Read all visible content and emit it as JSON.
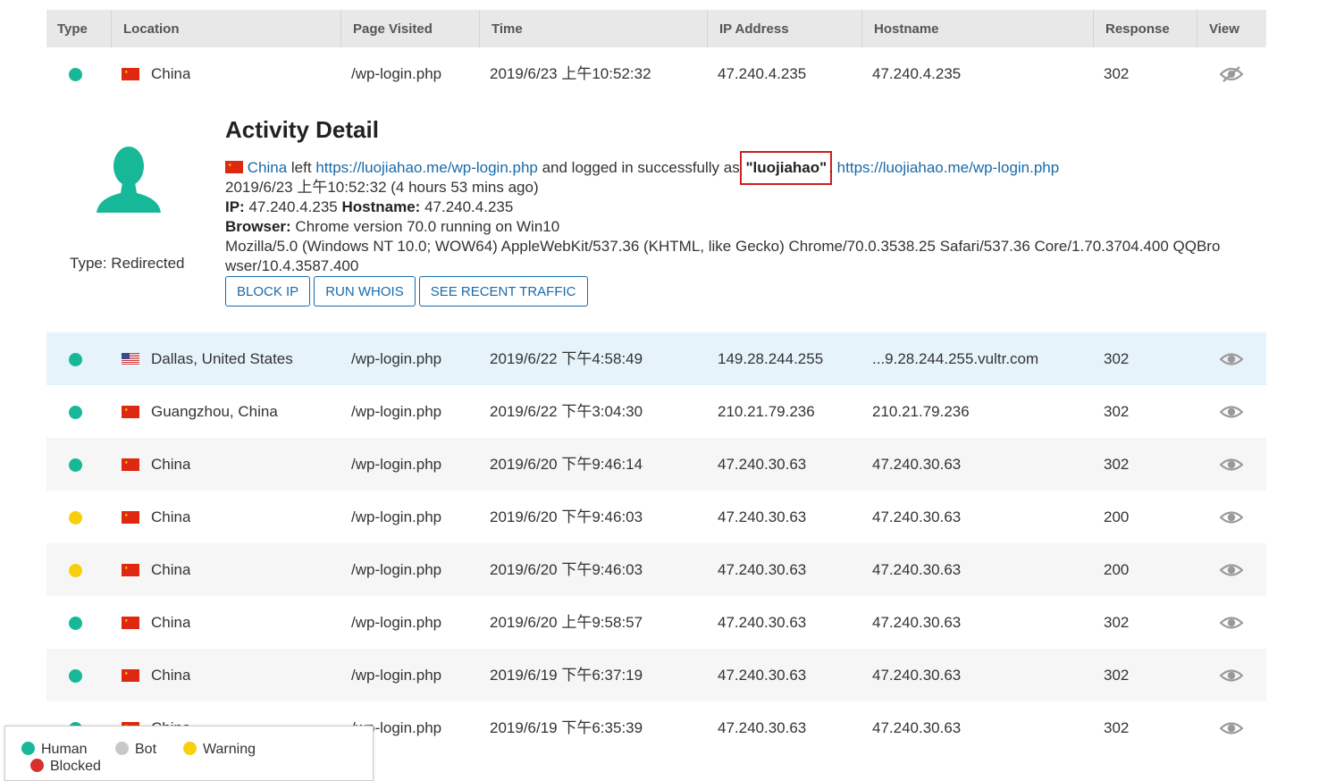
{
  "columns": [
    "Type",
    "Location",
    "Page Visited",
    "Time",
    "IP Address",
    "Hostname",
    "Response",
    "View"
  ],
  "colors": {
    "human": "#16b897",
    "bot": "#c8c8c8",
    "warning": "#f8cf0d",
    "blocked": "#d63030",
    "link": "#1a6aa8",
    "highlight": "#cc1f1f"
  },
  "first_row": {
    "type": "human",
    "flag": "cn",
    "location": "China",
    "page": "/wp-login.php",
    "time": "2019/6/23 上午10:52:32",
    "ip": "47.240.4.235",
    "hostname": "47.240.4.235",
    "response": "302",
    "view_icon": "eye-slash-icon"
  },
  "detail": {
    "title": "Activity Detail",
    "type_label": "Type: Redirected",
    "country": "China",
    "left_text": "left",
    "left_url": "https://luojiahao.me/wp-login.php",
    "login_text": "and logged in successfully as",
    "username": "\"luojiahao\"",
    "dest_url": "https://luojiahao.me/wp-login.php",
    "time_line": "2019/6/23 上午10:52:32 (4 hours 53 mins ago)",
    "ip_label": "IP:",
    "ip": "47.240.4.235",
    "hostname_label": "Hostname:",
    "hostname": "47.240.4.235",
    "browser_label": "Browser:",
    "browser": "Chrome version 70.0 running on Win10",
    "ua_line1": "Mozilla/5.0 (Windows NT 10.0; WOW64) AppleWebKit/537.36 (KHTML, like Gecko) Chrome/70.0.3538.25 Safari/537.36 Core/1.70.3704.400 QQBro",
    "ua_line2": "wser/10.4.3587.400",
    "buttons": [
      "BLOCK IP",
      "RUN WHOIS",
      "SEE RECENT TRAFFIC"
    ]
  },
  "rows": [
    {
      "type": "human",
      "flag": "us",
      "location": "Dallas, United States",
      "page": "/wp-login.php",
      "time": "2019/6/22 下午4:58:49",
      "ip": "149.28.244.255",
      "hostname": "...9.28.244.255.vultr.com",
      "response": "302"
    },
    {
      "type": "human",
      "flag": "cn",
      "location": "Guangzhou, China",
      "page": "/wp-login.php",
      "time": "2019/6/22 下午3:04:30",
      "ip": "210.21.79.236",
      "hostname": "210.21.79.236",
      "response": "302"
    },
    {
      "type": "human",
      "flag": "cn",
      "location": "China",
      "page": "/wp-login.php",
      "time": "2019/6/20 下午9:46:14",
      "ip": "47.240.30.63",
      "hostname": "47.240.30.63",
      "response": "302"
    },
    {
      "type": "warning",
      "flag": "cn",
      "location": "China",
      "page": "/wp-login.php",
      "time": "2019/6/20 下午9:46:03",
      "ip": "47.240.30.63",
      "hostname": "47.240.30.63",
      "response": "200"
    },
    {
      "type": "warning",
      "flag": "cn",
      "location": "China",
      "page": "/wp-login.php",
      "time": "2019/6/20 下午9:46:03",
      "ip": "47.240.30.63",
      "hostname": "47.240.30.63",
      "response": "200"
    },
    {
      "type": "human",
      "flag": "cn",
      "location": "China",
      "page": "/wp-login.php",
      "time": "2019/6/20 上午9:58:57",
      "ip": "47.240.30.63",
      "hostname": "47.240.30.63",
      "response": "302"
    },
    {
      "type": "human",
      "flag": "cn",
      "location": "China",
      "page": "/wp-login.php",
      "time": "2019/6/19 下午6:37:19",
      "ip": "47.240.30.63",
      "hostname": "47.240.30.63",
      "response": "302"
    },
    {
      "type": "human",
      "flag": "cn",
      "location": "China",
      "page": "/wp-login.php",
      "time": "2019/6/19 下午6:35:39",
      "ip": "47.240.30.63",
      "hostname": "47.240.30.63",
      "response": "302"
    }
  ],
  "legend": [
    {
      "key": "human",
      "label": "Human"
    },
    {
      "key": "bot",
      "label": "Bot"
    },
    {
      "key": "warning",
      "label": "Warning"
    },
    {
      "key": "blocked",
      "label": "Blocked"
    }
  ]
}
